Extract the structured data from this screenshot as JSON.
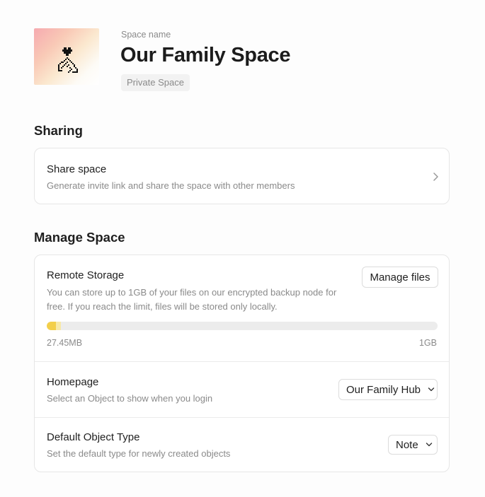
{
  "header": {
    "space_label": "Space name",
    "space_title": "Our Family Space",
    "privacy_badge": "Private Space",
    "icon": "family-heart-icon"
  },
  "sharing": {
    "section_title": "Sharing",
    "share_space": {
      "title": "Share space",
      "description": "Generate invite link and share the space with other members"
    }
  },
  "manage_space": {
    "section_title": "Manage Space",
    "remote_storage": {
      "title": "Remote Storage",
      "description_line1": "You can store up to 1GB of your files on our encrypted backup node for",
      "description_line2": "free. If you reach the limit, files will be stored only locally.",
      "manage_button_label": "Manage files",
      "used_label": "27.45MB",
      "limit_label": "1GB",
      "used_fraction": 0.027
    },
    "homepage": {
      "title": "Homepage",
      "description": "Select an Object to show when you login",
      "selected_value": "Our Family Hub"
    },
    "default_object_type": {
      "title": "Default Object Type",
      "description": "Set the default type for newly created objects",
      "selected_value": "Note"
    }
  },
  "colors": {
    "progress_fill": "#f3cf4a",
    "progress_track": "#ececec",
    "muted_text": "#8a8a8a"
  }
}
